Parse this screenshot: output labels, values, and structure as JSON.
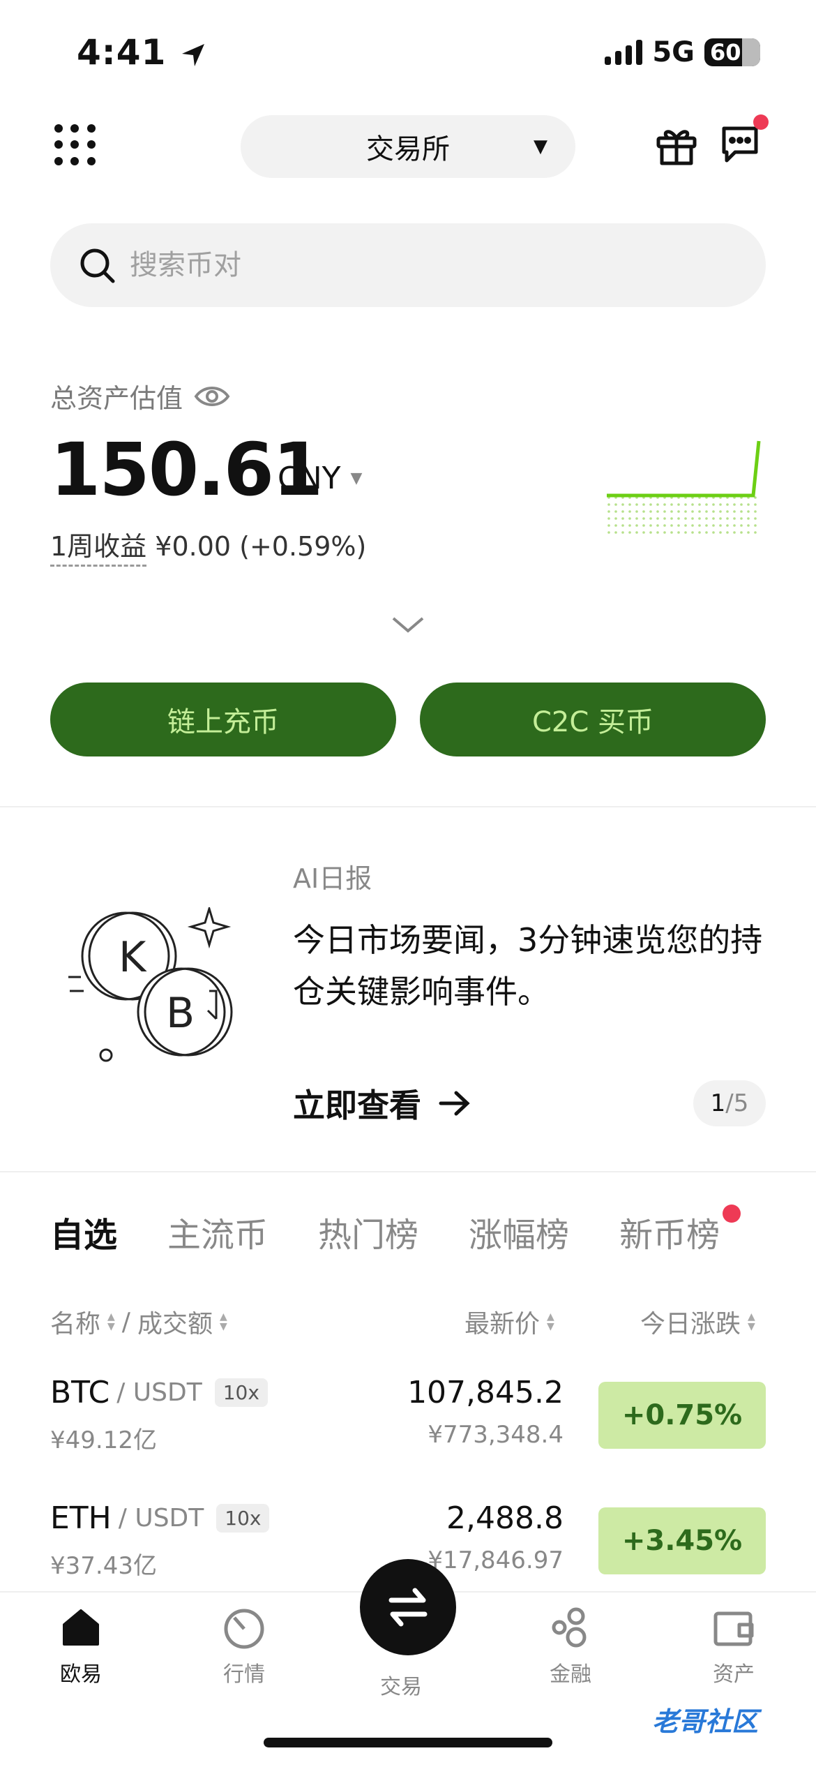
{
  "status_bar": {
    "time": "4:41",
    "network": "5G",
    "battery": "60"
  },
  "header": {
    "exchange_label": "交易所"
  },
  "search": {
    "placeholder": "搜索币对"
  },
  "assets": {
    "label": "总资产估值",
    "value": "150.61",
    "currency": "CNY",
    "weekly_label": "1周收益",
    "weekly_value": "¥0.00 (+0.59%)"
  },
  "actions": {
    "deposit": "链上充币",
    "c2c": "C2C 买币"
  },
  "ai_card": {
    "tag": "AI日报",
    "body": "今日市场要闻，3分钟速览您的持仓关键影响事件。",
    "cta": "立即查看",
    "pager_current": "1",
    "pager_total": "/5"
  },
  "tabs": [
    "自选",
    "主流币",
    "热门榜",
    "涨幅榜",
    "新币榜"
  ],
  "columns": {
    "name": "名称",
    "sep": "/",
    "volume": "成交额",
    "price": "最新价",
    "change": "今日涨跌"
  },
  "rows": [
    {
      "symbol": "BTC",
      "quote": "/ USDT",
      "leverage": "10x",
      "volume": "¥49.12亿",
      "price": "107,845.2",
      "price_cny": "¥773,348.4",
      "change": "+0.75%"
    },
    {
      "symbol": "ETH",
      "quote": "/ USDT",
      "leverage": "10x",
      "volume": "¥37.43亿",
      "price": "2,488.8",
      "price_cny": "¥17,846.97",
      "change": "+3.45%"
    }
  ],
  "nav": {
    "home": "欧易",
    "market": "行情",
    "trade": "交易",
    "finance": "金融",
    "assets": "资产"
  },
  "watermark": "老哥社区",
  "colors": {
    "accent_green": "#2d6a1c",
    "accent_light": "#c4ee98",
    "change_bg": "#cdeaa4",
    "red_dot": "#ee3a55"
  }
}
